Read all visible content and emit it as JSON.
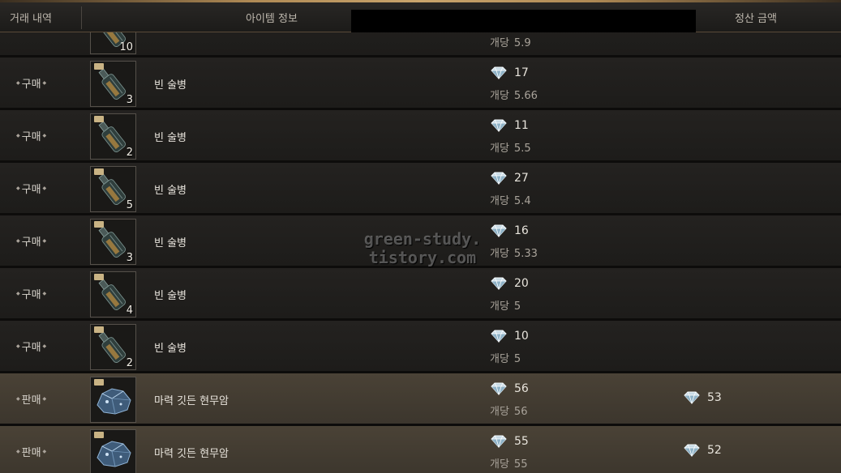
{
  "header": {
    "col_history": "거래 내역",
    "col_item": "아이템 정보",
    "col_settle": "정산 금액"
  },
  "icons": {
    "bottle": "bottle-icon",
    "ore": "ore-icon",
    "currency": "diamond-gem-icon"
  },
  "rows": [
    {
      "type": "",
      "name": "",
      "qty": "10",
      "total": "",
      "per_label": "개당",
      "per": "5.9",
      "settle": "",
      "kind": "bottle",
      "sell": false
    },
    {
      "type": "구매",
      "name": "빈 술병",
      "qty": "3",
      "total": "17",
      "per_label": "개당",
      "per": "5.66",
      "settle": "",
      "kind": "bottle",
      "sell": false
    },
    {
      "type": "구매",
      "name": "빈 술병",
      "qty": "2",
      "total": "11",
      "per_label": "개당",
      "per": "5.5",
      "settle": "",
      "kind": "bottle",
      "sell": false
    },
    {
      "type": "구매",
      "name": "빈 술병",
      "qty": "5",
      "total": "27",
      "per_label": "개당",
      "per": "5.4",
      "settle": "",
      "kind": "bottle",
      "sell": false
    },
    {
      "type": "구매",
      "name": "빈 술병",
      "qty": "3",
      "total": "16",
      "per_label": "개당",
      "per": "5.33",
      "settle": "",
      "kind": "bottle",
      "sell": false
    },
    {
      "type": "구매",
      "name": "빈 술병",
      "qty": "4",
      "total": "20",
      "per_label": "개당",
      "per": "5",
      "settle": "",
      "kind": "bottle",
      "sell": false
    },
    {
      "type": "구매",
      "name": "빈 술병",
      "qty": "2",
      "total": "10",
      "per_label": "개당",
      "per": "5",
      "settle": "",
      "kind": "bottle",
      "sell": false
    },
    {
      "type": "판매",
      "name": "마력 깃든 현무암",
      "qty": "",
      "total": "56",
      "per_label": "개당",
      "per": "56",
      "settle": "53",
      "kind": "ore",
      "sell": true
    },
    {
      "type": "판매",
      "name": "마력 깃든 현무암",
      "qty": "",
      "total": "55",
      "per_label": "개당",
      "per": "55",
      "settle": "52",
      "kind": "ore",
      "sell": true
    }
  ],
  "watermark": {
    "line1": "green-study.",
    "line2": "tistory.com"
  },
  "colors": {
    "sell_row": "#4a4236",
    "buy_row": "#242220",
    "gold_accent": "#c9a46c"
  }
}
